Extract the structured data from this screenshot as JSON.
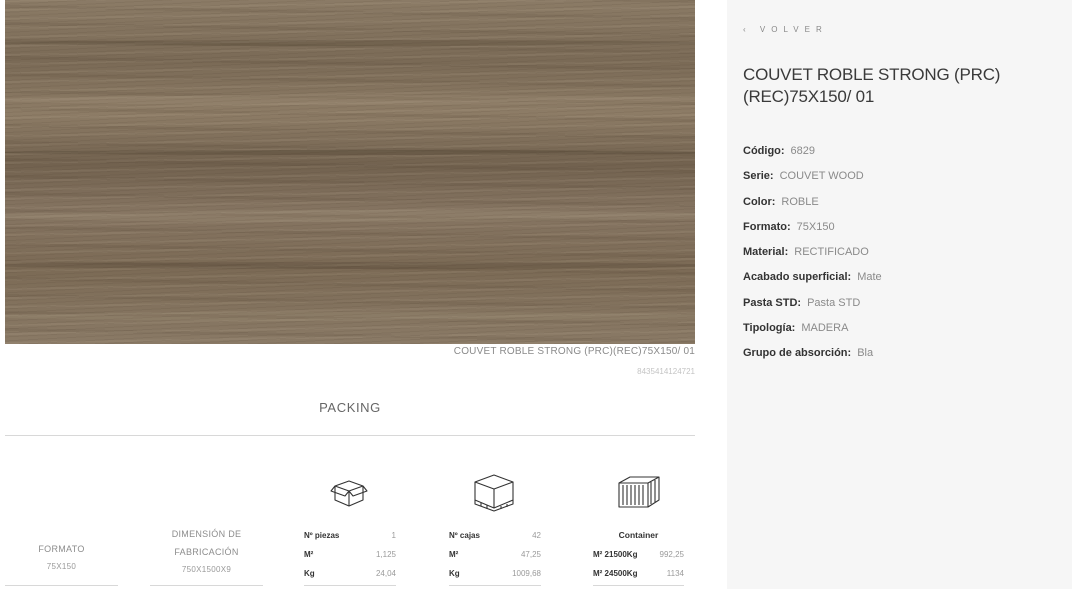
{
  "product": {
    "title": "COUVET ROBLE STRONG (PRC)(REC)75X150/ 01",
    "image_caption": "COUVET ROBLE STRONG (PRC)(REC)75X150/ 01",
    "ean": "8435414124721"
  },
  "nav": {
    "back_label": "‹ VOLVER"
  },
  "specs": [
    {
      "label": "Código:",
      "value": "6829"
    },
    {
      "label": "Serie:",
      "value": "COUVET WOOD"
    },
    {
      "label": "Color:",
      "value": "ROBLE"
    },
    {
      "label": "Formato:",
      "value": "75X150"
    },
    {
      "label": "Material:",
      "value": "RECTIFICADO"
    },
    {
      "label": "Acabado superficial:",
      "value": "Mate"
    },
    {
      "label": "Pasta STD:",
      "value": "Pasta STD"
    },
    {
      "label": "Tipología:",
      "value": "MADERA"
    },
    {
      "label": "Grupo de absorción:",
      "value": "Bla"
    }
  ],
  "packing": {
    "title": "PACKING",
    "formato": {
      "label": "FORMATO",
      "value": "75X150"
    },
    "dimension": {
      "label_line1": "DIMENSIÓN DE",
      "label_line2": "FABRICACIÓN",
      "value": "750X1500X9"
    },
    "piezas": {
      "icon": "box-icon",
      "rows": [
        {
          "k": "Nº piezas",
          "v": "1"
        },
        {
          "k": "M²",
          "v": "1,125"
        },
        {
          "k": "Kg",
          "v": "24,04"
        }
      ]
    },
    "cajas": {
      "icon": "pallet-icon",
      "rows": [
        {
          "k": "Nº cajas",
          "v": "42"
        },
        {
          "k": "M²",
          "v": "47,25"
        },
        {
          "k": "Kg",
          "v": "1009,68"
        }
      ]
    },
    "container": {
      "icon": "container-icon",
      "heading": "Container",
      "rows": [
        {
          "k": "M² 21500Kg",
          "v": "992,25"
        },
        {
          "k": "M² 24500Kg",
          "v": "1134"
        }
      ]
    }
  },
  "colors": {
    "panel_bg": "#f6f6f6",
    "wood": "#7f6f5b",
    "rule": "#d8d8d8"
  }
}
